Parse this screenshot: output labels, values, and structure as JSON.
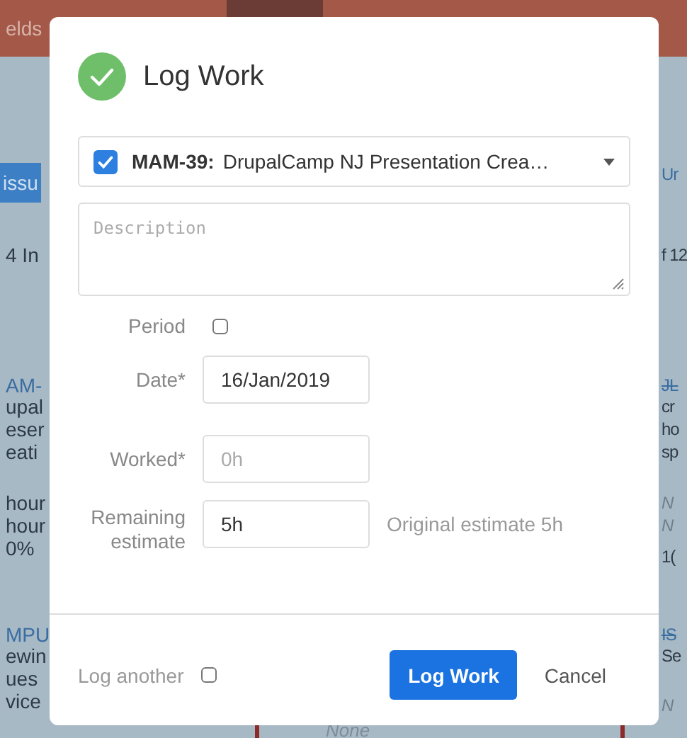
{
  "background": {
    "header_text": "elds",
    "left": [
      {
        "kind": "button",
        "lines": [
          "issu"
        ]
      },
      {
        "kind": "text",
        "lines": [
          "4 In"
        ]
      },
      {
        "kind": "link",
        "lines": [
          "AM-"
        ]
      },
      {
        "kind": "text",
        "lines": [
          "upal",
          "eser",
          "eati"
        ]
      },
      {
        "kind": "text",
        "lines": [
          "hour",
          "hour",
          "0%"
        ]
      },
      {
        "kind": "link",
        "lines": [
          "MPU"
        ]
      },
      {
        "kind": "text",
        "lines": [
          "ewin",
          "ues",
          "vice"
        ]
      }
    ],
    "right": [
      {
        "kind": "link",
        "lines": [
          "Ur"
        ]
      },
      {
        "kind": "text",
        "lines": [
          "f 12"
        ]
      },
      {
        "kind": "strike",
        "lines": [
          "JL"
        ]
      },
      {
        "kind": "text",
        "lines": [
          "cr",
          "ho",
          "sp"
        ]
      },
      {
        "kind": "italic",
        "lines": [
          "N",
          "N"
        ]
      },
      {
        "kind": "text",
        "lines": [
          "1("
        ]
      },
      {
        "kind": "strike",
        "lines": [
          "IS"
        ]
      },
      {
        "kind": "text",
        "lines": [
          "Se"
        ]
      },
      {
        "kind": "italic",
        "lines": [
          "N"
        ]
      }
    ],
    "bottom_text": "None"
  },
  "dialog": {
    "title": "Log Work",
    "issue": {
      "checked": true,
      "key": "MAM-39:",
      "summary": "DrupalCamp NJ Presentation Crea…"
    },
    "description": {
      "placeholder": "Description"
    },
    "period": {
      "label": "Period",
      "checked": false
    },
    "date": {
      "label": "Date*",
      "value": "16/Jan/2019"
    },
    "worked": {
      "label": "Worked*",
      "placeholder": "0h"
    },
    "remaining": {
      "label": "Remaining estimate",
      "value": "5h",
      "note": "Original estimate 5h"
    },
    "log_another": {
      "label": "Log another",
      "checked": false
    },
    "buttons": [
      {
        "kind": "primary",
        "label": "Log Work"
      },
      {
        "kind": "secondary",
        "label": "Cancel"
      }
    ]
  }
}
